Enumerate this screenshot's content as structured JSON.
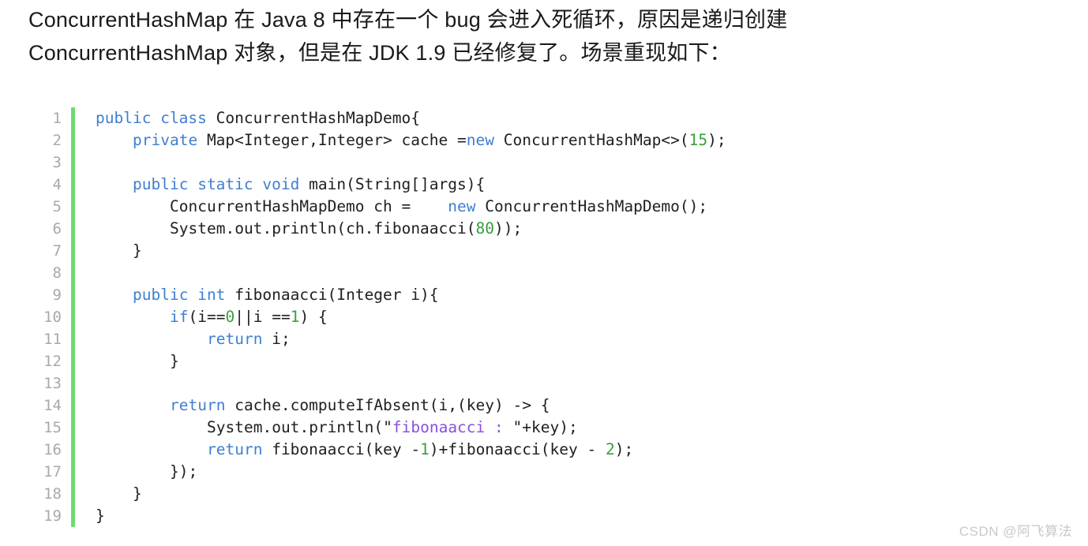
{
  "article": {
    "intro_text": "ConcurrentHashMap 在 Java 8 中存在一个 bug 会进入死循环，原因是递归创建 ConcurrentHashMap 对象，但是在 JDK 1.9 已经修复了。场景重现如下："
  },
  "code_block": {
    "language": "java",
    "accent_color": "#6fdb6f",
    "gutter_color": "#a9a9a9",
    "background_color": "#ffffff",
    "keyword_color": "#3f7fd0",
    "number_color": "#37a03a",
    "string_color": "#8a4fe0",
    "plain_color": "#202020",
    "line_numbers": [
      "1",
      "2",
      "3",
      "4",
      "5",
      "6",
      "7",
      "8",
      "9",
      "10",
      "11",
      "12",
      "13",
      "14",
      "15",
      "16",
      "17",
      "18",
      "19"
    ],
    "lines": [
      {
        "n": "1",
        "text": "public class ConcurrentHashMapDemo{"
      },
      {
        "n": "2",
        "text": "    private Map<Integer,Integer> cache =new ConcurrentHashMap<>(15);"
      },
      {
        "n": "3",
        "text": ""
      },
      {
        "n": "4",
        "text": "    public static void main(String[]args){"
      },
      {
        "n": "5",
        "text": "        ConcurrentHashMapDemo ch =    new ConcurrentHashMapDemo();"
      },
      {
        "n": "6",
        "text": "        System.out.println(ch.fibonaacci(80));"
      },
      {
        "n": "7",
        "text": "    }"
      },
      {
        "n": "8",
        "text": ""
      },
      {
        "n": "9",
        "text": "    public int fibonaacci(Integer i){"
      },
      {
        "n": "10",
        "text": "        if(i==0||i ==1) {"
      },
      {
        "n": "11",
        "text": "            return i;"
      },
      {
        "n": "12",
        "text": "        }"
      },
      {
        "n": "13",
        "text": ""
      },
      {
        "n": "14",
        "text": "        return cache.computeIfAbsent(i,(key) -> {"
      },
      {
        "n": "15",
        "text": "            System.out.println(\"fibonaacci : \"+key);"
      },
      {
        "n": "16",
        "text": "            return fibonaacci(key -1)+fibonaacci(key - 2);"
      },
      {
        "n": "17",
        "text": "        });"
      },
      {
        "n": "18",
        "text": "    }"
      },
      {
        "n": "19",
        "text": "}"
      }
    ]
  },
  "watermark": {
    "text": "CSDN @阿飞算法"
  }
}
